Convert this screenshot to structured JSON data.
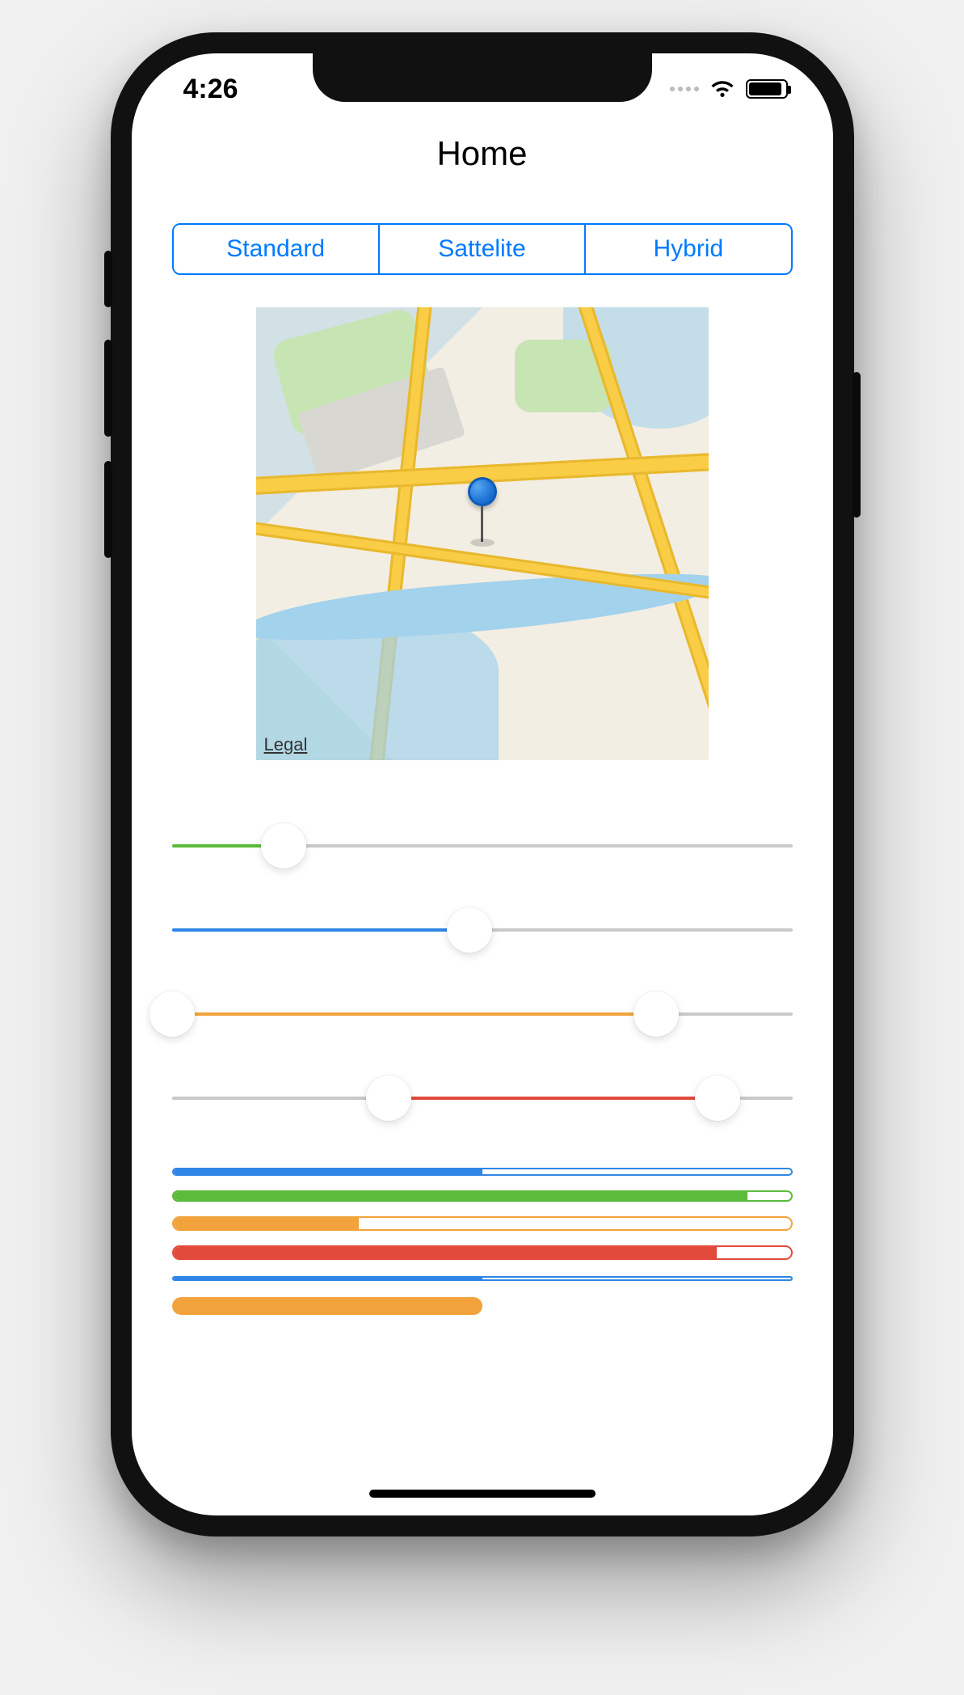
{
  "status": {
    "time": "4:26"
  },
  "nav": {
    "title": "Home"
  },
  "segments": {
    "items": [
      {
        "label": "Standard"
      },
      {
        "label": "Sattelite"
      },
      {
        "label": "Hybrid"
      }
    ]
  },
  "map": {
    "legal": "Legal"
  },
  "colors": {
    "blue": "#2f86e6",
    "green": "#5bbb3b",
    "orange": "#f2a33c",
    "red": "#e24a3b"
  },
  "sliders": [
    {
      "type": "single",
      "value": 0.18,
      "fill": "green"
    },
    {
      "type": "single",
      "value": 0.48,
      "fill": "blue"
    },
    {
      "type": "range",
      "low": 0.0,
      "high": 0.78,
      "fill": "orange"
    },
    {
      "type": "range",
      "low": 0.35,
      "high": 0.88,
      "fill": "red"
    }
  ],
  "progress_bars": [
    {
      "value": 0.5,
      "color": "blue",
      "height": 10,
      "style": "outlined",
      "gap": 18
    },
    {
      "value": 0.93,
      "color": "green",
      "height": 14,
      "style": "outlined",
      "gap": 18
    },
    {
      "value": 0.3,
      "color": "orange",
      "height": 18,
      "style": "outlined",
      "gap": 18
    },
    {
      "value": 0.88,
      "color": "red",
      "height": 18,
      "style": "outlined",
      "gap": 20
    },
    {
      "value": 0.5,
      "color": "blue",
      "height": 6,
      "style": "outlined",
      "gap": 20
    },
    {
      "value": 0.5,
      "color": "orange",
      "height": 22,
      "style": "filled",
      "gap": 0
    }
  ]
}
